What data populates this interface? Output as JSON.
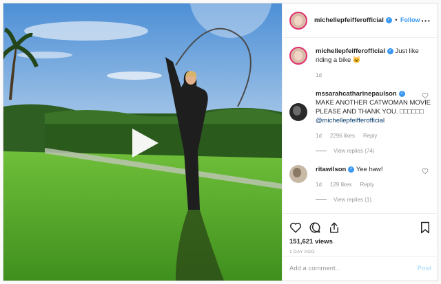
{
  "header": {
    "username": "michellepfeifferofficial",
    "separator": "•",
    "follow_label": "Follow",
    "more_label": "•••"
  },
  "caption": {
    "username": "michellepfeifferofficial",
    "text": "Just like riding a bike 🐱",
    "age": "1d"
  },
  "comments": [
    {
      "username": "mssarahcatharinepaulson",
      "text": "MAKE ANOTHER CATWOMAN MOVIE PLEASE AND THANK YOU. □□□□□□",
      "mention": "@michellepfeifferofficial",
      "age": "1d",
      "likes": "2296 likes",
      "reply_label": "Reply",
      "view_replies": "View replies (74)"
    },
    {
      "username": "ritawilson",
      "text": "Yee haw!",
      "age": "1d",
      "likes": "129 likes",
      "reply_label": "Reply",
      "view_replies": "View replies (1)"
    }
  ],
  "icons": {
    "like": "heart-icon",
    "comment": "comment-icon",
    "share": "share-icon",
    "save": "bookmark-icon",
    "play": "play-icon",
    "verified": "verified-badge-icon"
  },
  "stats": {
    "views": "151,621 views",
    "posted": "1 DAY AGO"
  },
  "add_comment": {
    "placeholder": "Add a comment...",
    "post_label": "Post"
  },
  "colors": {
    "accent": "#3897f0",
    "post_disabled": "#b2dffc",
    "muted": "#999999"
  }
}
